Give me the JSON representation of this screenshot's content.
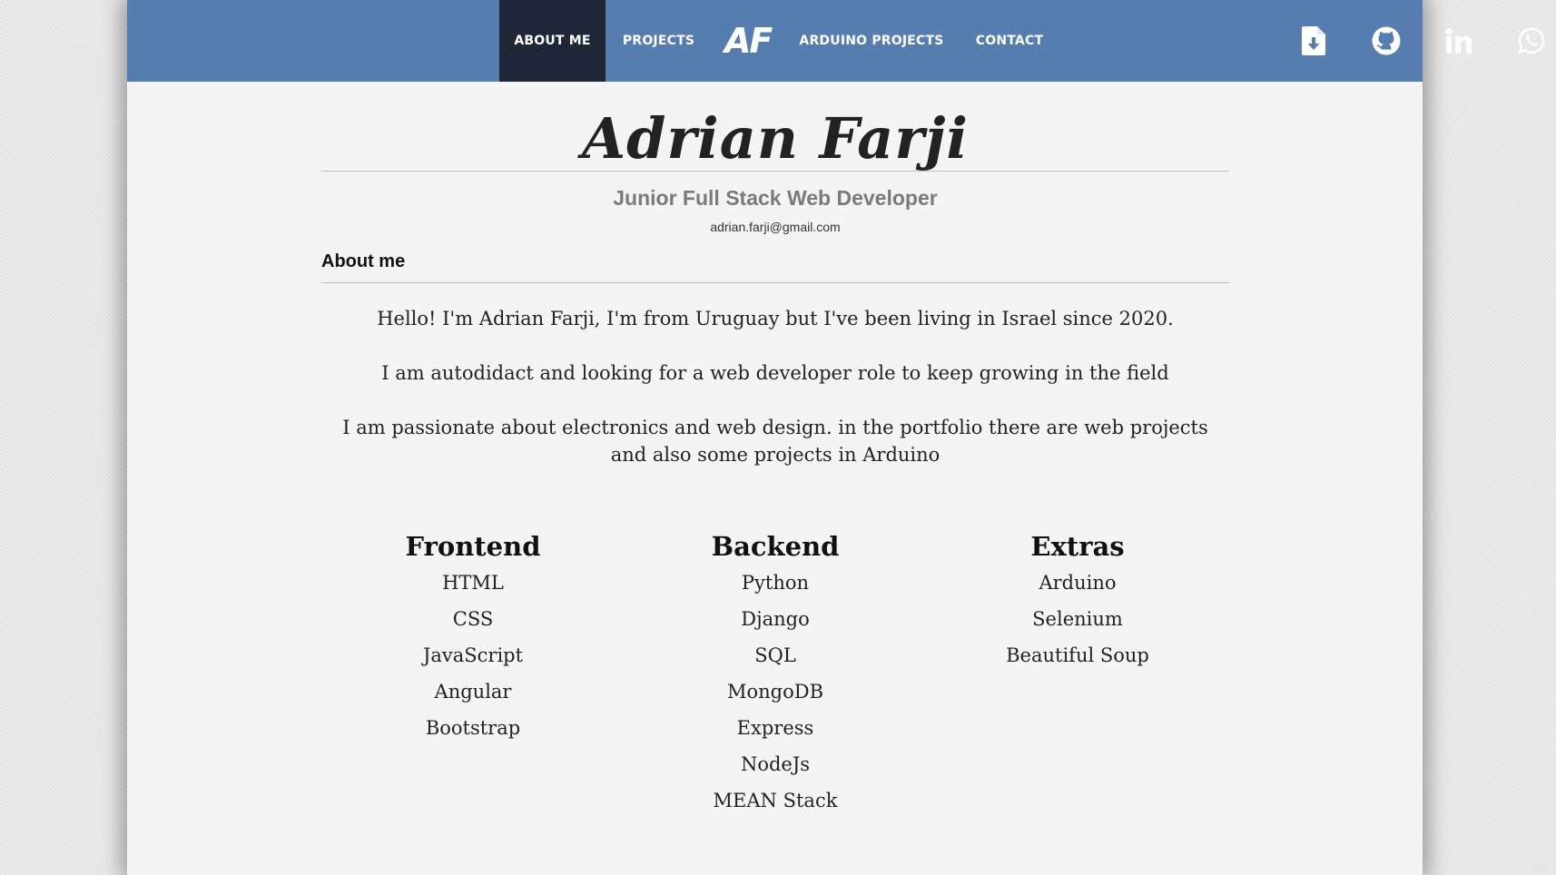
{
  "nav": {
    "links": {
      "about": "ABOUT ME",
      "projects": "PROJECTS",
      "arduino": "ARDUINO PROJECTS",
      "contact": "CONTACT"
    },
    "logo": "AF",
    "icons": [
      "download-cv-icon",
      "github-icon",
      "linkedin-icon",
      "whatsapp-icon"
    ]
  },
  "header": {
    "name": "Adrian Farji",
    "subtitle": "Junior Full Stack Web Developer",
    "email": "adrian.farji@gmail.com"
  },
  "about": {
    "heading": "About me",
    "paragraphs": [
      "Hello! I'm Adrian Farji, I'm from Uruguay but I've been living in Israel since 2020.",
      "I am autodidact and looking for a web developer role to keep growing in the field",
      "I am passionate about electronics and web design. in the portfolio there are web projects and also some projects in Arduino"
    ]
  },
  "skills": {
    "frontend": {
      "title": "Frontend",
      "items": [
        "HTML",
        "CSS",
        "JavaScript",
        "Angular",
        "Bootstrap"
      ]
    },
    "backend": {
      "title": "Backend",
      "items": [
        "Python",
        "Django",
        "SQL",
        "MongoDB",
        "Express",
        "NodeJs",
        "MEAN Stack"
      ]
    },
    "extras": {
      "title": "Extras",
      "items": [
        "Arduino",
        "Selenium",
        "Beautiful Soup"
      ]
    }
  },
  "colors": {
    "navbar": "#557db0",
    "nav_active": "#1d2738",
    "page_background": "#f4f4f4"
  }
}
